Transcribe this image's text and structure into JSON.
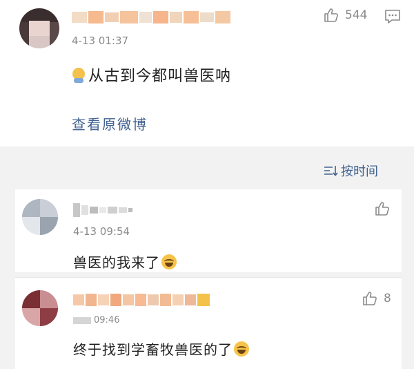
{
  "main_post": {
    "timestamp": "4-13 01:37",
    "text": "从古到今都叫兽医呐",
    "view_original": "查看原微博",
    "like_count": "544"
  },
  "sort": {
    "label": "按时间"
  },
  "replies": [
    {
      "timestamp": "4-13 09:54",
      "text": "兽医的我来了",
      "like_count": ""
    },
    {
      "timestamp": "09:46",
      "text": "终于找到学畜牧兽医的了",
      "like_count": "8"
    }
  ]
}
